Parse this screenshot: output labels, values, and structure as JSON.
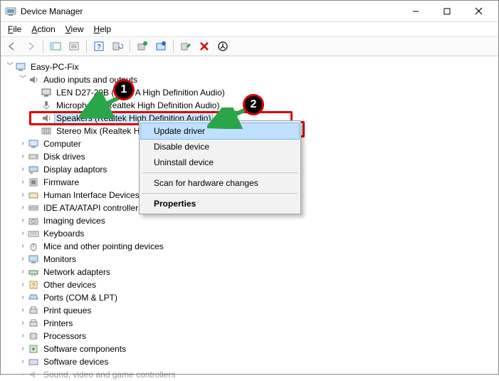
{
  "window": {
    "title": "Device Manager"
  },
  "menu": {
    "file": "File",
    "action": "Action",
    "view": "View",
    "help": "Help"
  },
  "tree": {
    "root": "Easy-PC-Fix",
    "audio_cat": "Audio inputs and outputs",
    "audio_children": {
      "a0": "LEN D27-20B (AMD A High Definition Audio)",
      "a1": "Microphone (Realtek High Definition Audio)",
      "a2": "Speakers (Realtek High Definition Audio)",
      "a3": "Stereo Mix (Realtek High Definition Audio)"
    },
    "cats": {
      "c0": "Computer",
      "c1": "Disk drives",
      "c2": "Display adaptors",
      "c3": "Firmware",
      "c4": "Human Interface Devices",
      "c5": "IDE ATA/ATAPI controllers",
      "c6": "Imaging devices",
      "c7": "Keyboards",
      "c8": "Mice and other pointing devices",
      "c9": "Monitors",
      "c10": "Network adapters",
      "c11": "Other devices",
      "c12": "Ports (COM & LPT)",
      "c13": "Print queues",
      "c14": "Printers",
      "c15": "Processors",
      "c16": "Software components",
      "c17": "Software devices",
      "c18": "Sound, video and game controllers"
    }
  },
  "context_menu": {
    "update": "Update driver",
    "disable": "Disable device",
    "uninstall": "Uninstall device",
    "scan": "Scan for hardware changes",
    "properties": "Properties"
  },
  "badges": {
    "one": "1",
    "two": "2"
  }
}
